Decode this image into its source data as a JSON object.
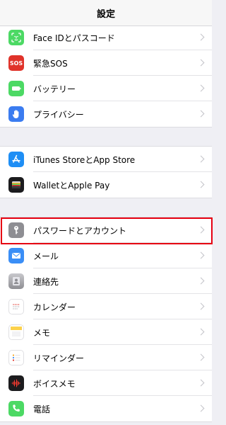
{
  "header": {
    "title": "設定"
  },
  "groups": [
    {
      "items": [
        {
          "label": "Face IDとパスコード",
          "icon": "face-id-icon",
          "color": "#4cd964"
        },
        {
          "label": "緊急SOS",
          "icon": "sos-icon",
          "color": "#e0332a",
          "icon_text": "SOS"
        },
        {
          "label": "バッテリー",
          "icon": "battery-icon",
          "color": "#4cd964"
        },
        {
          "label": "プライバシー",
          "icon": "hand-icon",
          "color": "#3b7cf0"
        }
      ]
    },
    {
      "items": [
        {
          "label": "iTunes StoreとApp Store",
          "icon": "app-store-icon",
          "color": "#1e8ef5"
        },
        {
          "label": "WalletとApple Pay",
          "icon": "wallet-icon",
          "color": "#1c1c1e"
        }
      ]
    },
    {
      "items": [
        {
          "label": "パスワードとアカウント",
          "icon": "key-icon",
          "color": "#8e8e93"
        },
        {
          "label": "メール",
          "icon": "mail-icon",
          "color": "#3a8ef6"
        },
        {
          "label": "連絡先",
          "icon": "contacts-icon",
          "color": "#9a9aa0"
        },
        {
          "label": "カレンダー",
          "icon": "calendar-icon",
          "color": "#ffffff"
        },
        {
          "label": "メモ",
          "icon": "notes-icon",
          "color": "#ffffff"
        },
        {
          "label": "リマインダー",
          "icon": "reminders-icon",
          "color": "#ffffff"
        },
        {
          "label": "ボイスメモ",
          "icon": "voice-memos-icon",
          "color": "#1c1c1e"
        },
        {
          "label": "電話",
          "icon": "phone-icon",
          "color": "#4cd964"
        }
      ]
    }
  ],
  "highlight_color": "#e60012"
}
